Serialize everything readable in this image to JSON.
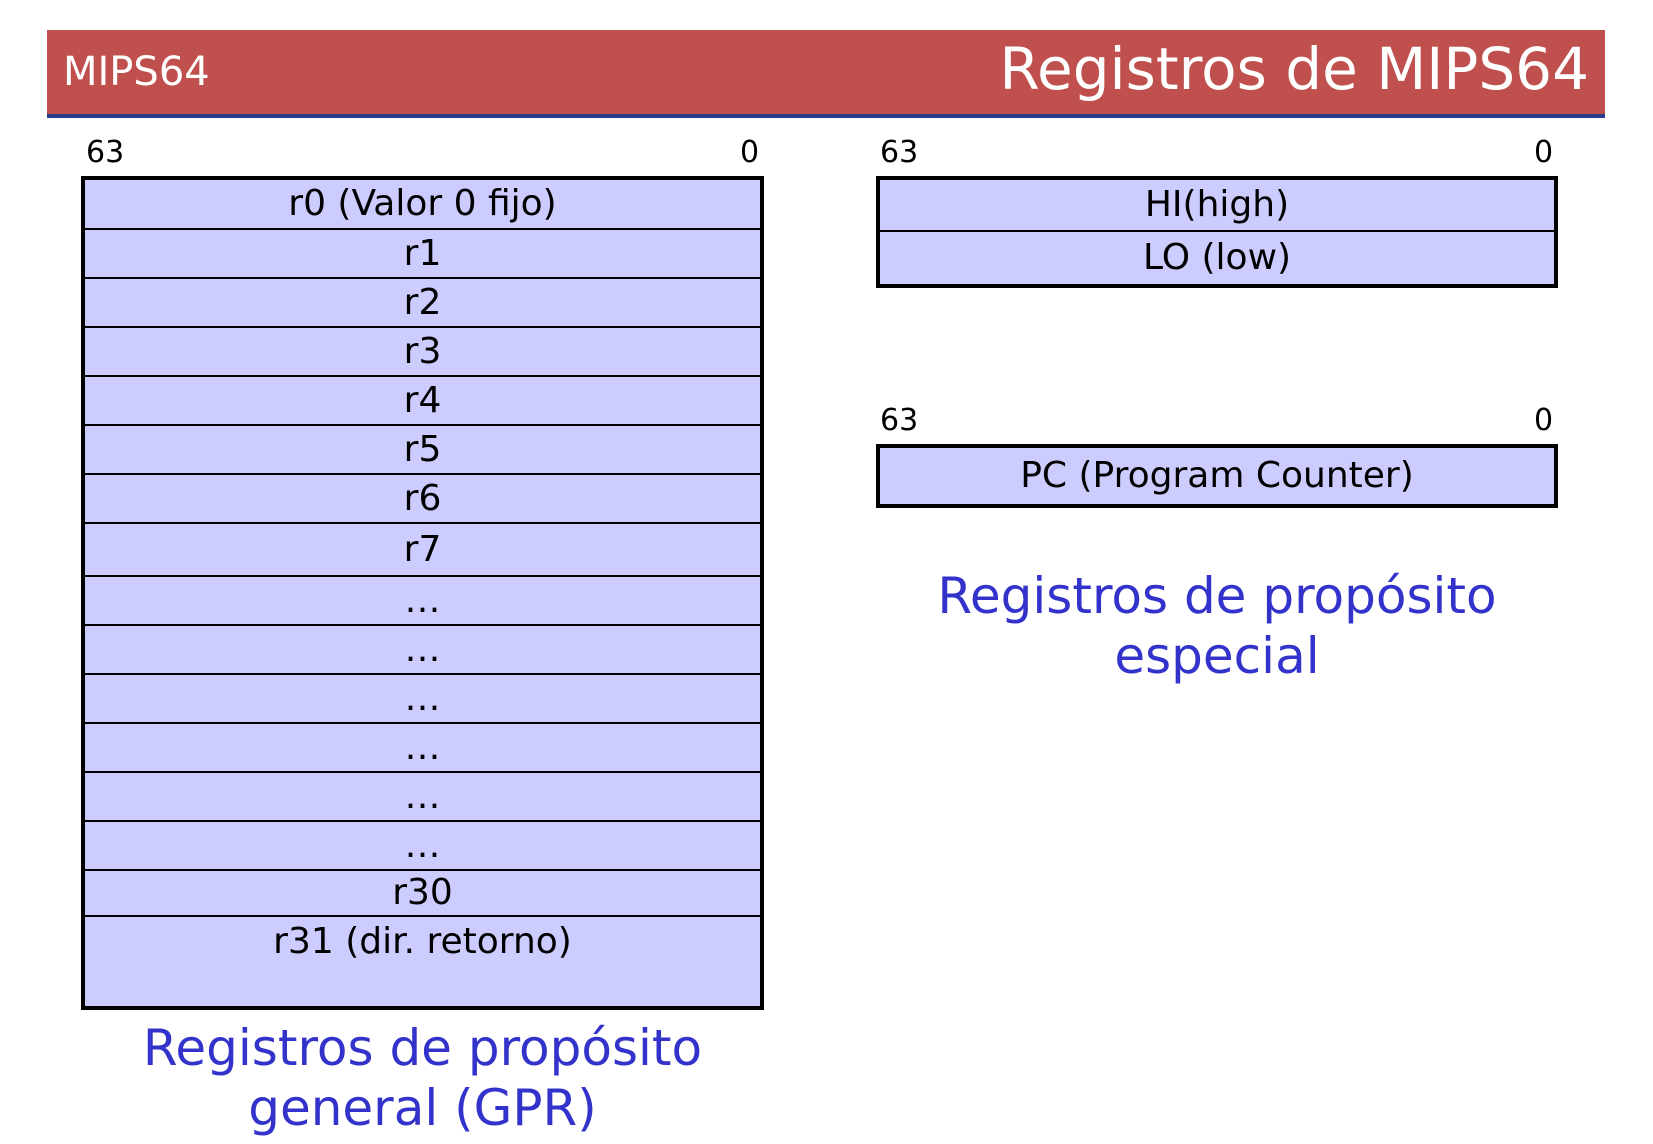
{
  "header": {
    "left_title": "MIPS64",
    "right_title": "Registros de MIPS64",
    "background_color": "#c0504d",
    "underline_color": "#2a3a8c"
  },
  "gpr": {
    "bit_high": "63",
    "bit_low": "0",
    "rows": [
      "r0 (Valor 0 fijo)",
      "r1",
      "r2",
      "r3",
      "r4",
      "r5",
      "r6",
      "r7",
      "…",
      "…",
      "…",
      "…",
      "…",
      "…",
      "r30",
      "r31 (dir. retorno)"
    ],
    "caption_line1": "Registros de propósito",
    "caption_line2": "general (GPR)"
  },
  "special": {
    "hilo": {
      "bit_high": "63",
      "bit_low": "0",
      "rows": [
        "HI(high)",
        "LO (low)"
      ]
    },
    "pc": {
      "bit_high": "63",
      "bit_low": "0",
      "rows": [
        "PC (Program Counter)"
      ]
    },
    "caption_line1": "Registros de propósito",
    "caption_line2": "especial"
  },
  "colors": {
    "register_fill": "#ccccff",
    "caption_text": "#3333cc"
  }
}
